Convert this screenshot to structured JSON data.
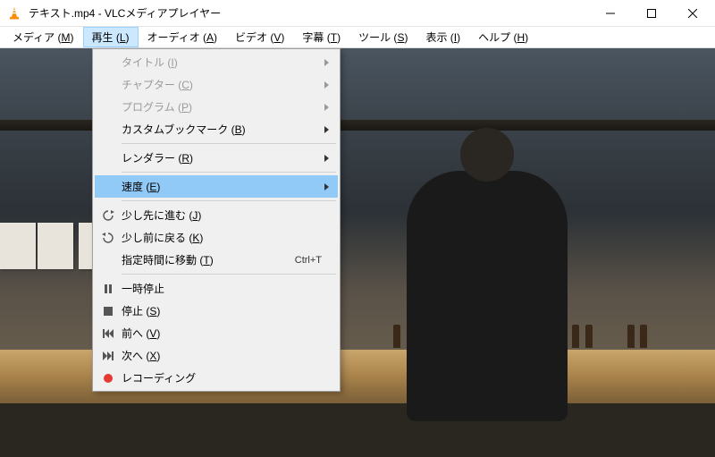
{
  "window": {
    "title": "テキスト.mp4 - VLCメディアプレイヤー"
  },
  "menubar": {
    "items": [
      {
        "label": "メディア",
        "mn": "M"
      },
      {
        "label": "再生",
        "mn": "L"
      },
      {
        "label": "オーディオ",
        "mn": "A"
      },
      {
        "label": "ビデオ",
        "mn": "V"
      },
      {
        "label": "字幕",
        "mn": "T"
      },
      {
        "label": "ツール",
        "mn": "S"
      },
      {
        "label": "表示",
        "mn": "I"
      },
      {
        "label": "ヘルプ",
        "mn": "H"
      }
    ],
    "open_index": 1
  },
  "dropdown": {
    "groups": [
      [
        {
          "label": "タイトル",
          "mn": "I",
          "submenu": true,
          "disabled": true
        },
        {
          "label": "チャプター",
          "mn": "C",
          "submenu": true,
          "disabled": true
        },
        {
          "label": "プログラム",
          "mn": "P",
          "submenu": true,
          "disabled": true
        },
        {
          "label": "カスタムブックマーク",
          "mn": "B",
          "submenu": true
        }
      ],
      [
        {
          "label": "レンダラー",
          "mn": "R",
          "submenu": true
        }
      ],
      [
        {
          "label": "速度",
          "mn": "E",
          "submenu": true,
          "highlighted": true
        }
      ],
      [
        {
          "label": "少し先に進む",
          "mn": "J",
          "icon": "jump-fwd"
        },
        {
          "label": "少し前に戻る",
          "mn": "K",
          "icon": "jump-back"
        },
        {
          "label": "指定時間に移動",
          "mn": "T",
          "shortcut": "Ctrl+T"
        }
      ],
      [
        {
          "label": "一時停止",
          "icon": "pause"
        },
        {
          "label": "停止",
          "mn": "S",
          "icon": "stop"
        },
        {
          "label": "前へ",
          "mn": "V",
          "icon": "prev"
        },
        {
          "label": "次へ",
          "mn": "X",
          "icon": "next"
        },
        {
          "label": "レコーディング",
          "icon": "record"
        }
      ]
    ]
  }
}
